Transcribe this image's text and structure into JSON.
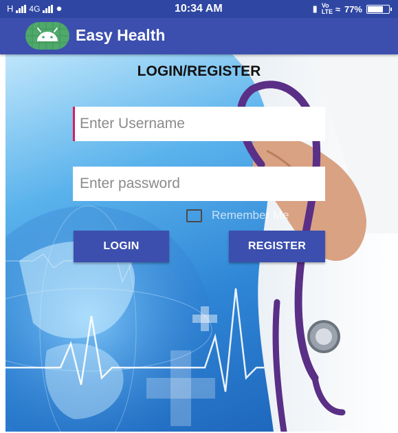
{
  "status_bar": {
    "carrier": "H",
    "network": "4G",
    "time": "10:34 AM",
    "volte": "Vo LTE",
    "battery": "77%",
    "battery_level": 0.77,
    "icons": [
      "signal-icon",
      "sim-icon",
      "vibrate-icon",
      "wifi-icon",
      "battery-icon"
    ]
  },
  "app_bar": {
    "title": "Easy Health",
    "logo_icon": "android-icon",
    "color": "#3c4fae"
  },
  "form": {
    "title": "LOGIN/REGISTER",
    "username": {
      "value": "",
      "placeholder": "Enter Username"
    },
    "password": {
      "value": "",
      "placeholder": "Enter password"
    },
    "remember_me": {
      "label": "Remember Me",
      "checked": false
    },
    "login_label": "LOGIN",
    "register_label": "REGISTER"
  },
  "colors": {
    "primary": "#3c4fae",
    "status_bar": "#2f47a3",
    "cursor": "#d81b60"
  }
}
